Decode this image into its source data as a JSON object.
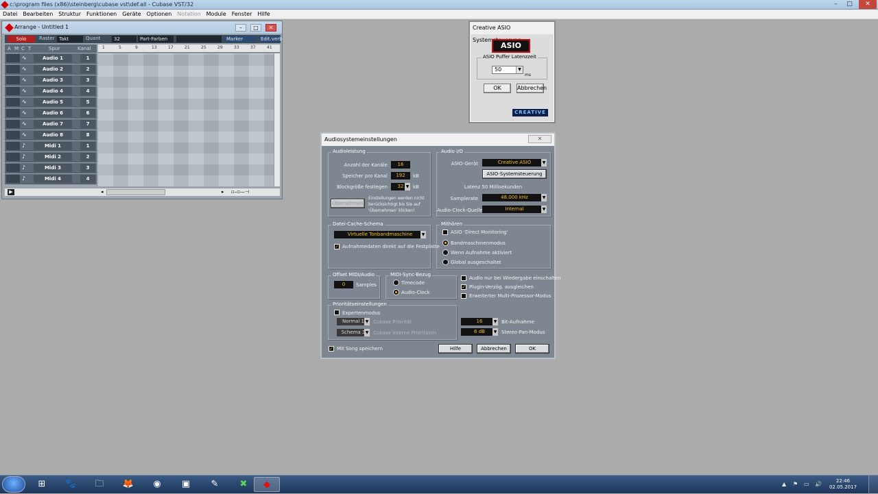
{
  "app": {
    "title": "c:\\program files (x86)\\steinberg\\cubase vst\\def.all - Cubase VST/32",
    "window_buttons": [
      "–",
      "□",
      "✕"
    ]
  },
  "menu": [
    "Datei",
    "Bearbeiten",
    "Struktur",
    "Funktionen",
    "Geräte",
    "Optionen",
    "Notation",
    "Module",
    "Fenster",
    "Hilfe"
  ],
  "menu_disabled": [
    "Notation"
  ],
  "arrange": {
    "title": "Arrange - Untitled 1",
    "solo": "Solo",
    "raster_label": "Raster",
    "raster_value": "Takt",
    "quant_label": "Quant",
    "quant_value": "32",
    "part_colors": "Part-Farben",
    "marker": "Marker",
    "edit": "Edit.verb",
    "col_a": "A",
    "col_m": "M",
    "col_c": "C",
    "col_t": "T",
    "col_spur": "Spur",
    "col_kanal": "Kanal",
    "ruler_marks": [
      "1",
      "5",
      "9",
      "13",
      "17",
      "21",
      "25",
      "29",
      "33",
      "37",
      "41"
    ],
    "tracks": [
      {
        "icon": "∿",
        "name": "Audio 1",
        "ch": "1"
      },
      {
        "icon": "∿",
        "name": "Audio 2",
        "ch": "2"
      },
      {
        "icon": "∿",
        "name": "Audio 3",
        "ch": "3"
      },
      {
        "icon": "∿",
        "name": "Audio 4",
        "ch": "4"
      },
      {
        "icon": "∿",
        "name": "Audio 5",
        "ch": "5"
      },
      {
        "icon": "∿",
        "name": "Audio 6",
        "ch": "6"
      },
      {
        "icon": "∿",
        "name": "Audio 7",
        "ch": "7"
      },
      {
        "icon": "∿",
        "name": "Audio 8",
        "ch": "8"
      },
      {
        "icon": "♪",
        "name": "Midi 1",
        "ch": "1"
      },
      {
        "icon": "♪",
        "name": "Midi 2",
        "ch": "2"
      },
      {
        "icon": "♪",
        "name": "Midi 3",
        "ch": "3"
      },
      {
        "icon": "♪",
        "name": "Midi 4",
        "ch": "4"
      }
    ]
  },
  "asio": {
    "title": "Creative ASIO Systemsteuerung",
    "logo": "ASIO",
    "group": "ASIO Puffer Latenzzeit",
    "latency": "50",
    "unit": "ms",
    "ok": "OK",
    "cancel": "Abbrechen",
    "brand": "CREATIVE"
  },
  "audio": {
    "title": "Audiosystemeinstellungen",
    "close": "✕",
    "leistung": {
      "label": "Audioleistung",
      "channels_label": "Anzahl der Kanäle",
      "channels": "16",
      "mem_label": "Speicher pro Kanal",
      "mem": "192",
      "mem_unit": "kB",
      "block_label": "Blockgröße festlegen",
      "block": "32",
      "block_unit": "kB",
      "apply": "Übernehmen",
      "note": "Einstellungen werden nicht berücksichtigt bis Sie auf 'Übernehmen' klicken!"
    },
    "io": {
      "label": "Audio I/O",
      "device_label": "ASIO-Gerät",
      "device": "Creative ASIO",
      "control_btn": "ASIO-Systemsteuerung",
      "latency": "Latenz 50 Millisekunden",
      "rate_label": "Samplerate",
      "rate": "48.000 kHz",
      "clock_label": "Audio-Clock-Quelle",
      "clock": "Internal"
    },
    "cache": {
      "label": "Datei-Cache-Schema",
      "value": "Virtuelle Tonbandmaschine",
      "record_direct": "Aufnahmedaten direkt auf die Festplatte"
    },
    "monitor": {
      "label": "Mithören",
      "direct": "ASIO 'Direct Monitoring'",
      "opts": [
        "Bandmaschinenmodus",
        "Wenn Aufnahme aktiviert",
        "Global ausgeschaltet"
      ]
    },
    "offset": {
      "label": "Offset MIDI/Audio",
      "value": "0",
      "unit": "Samples"
    },
    "sync": {
      "label": "MIDI-Sync-Bezug",
      "opts": [
        "Timecode",
        "Audio-Clock"
      ]
    },
    "checks": [
      "Audio nur bei Wiedergabe einschalten",
      "Plugin-Verzög. ausgleichen",
      "Erweiterter Multi-Prozessor-Modus"
    ],
    "prio": {
      "label": "Prioritätseinstellungen",
      "expert": "Expertenmodus",
      "p1": "Normal 1",
      "p1_label": "Cubase Priorität",
      "p2": "Schema 3",
      "p2_label": "Cubase Interne Prioritäten"
    },
    "bits": {
      "value": "16",
      "label": "Bit-Aufnahme"
    },
    "pan": {
      "value": "6 dB",
      "label": "Stereo-Pan-Modus"
    },
    "save_song": "Mit Song speichern",
    "help": "Hilfe",
    "cancel": "Abbrechen",
    "ok": "OK"
  },
  "taskbar": {
    "apps": [
      "⊞",
      "🐾",
      "🗀",
      "🦊",
      "◉",
      "▣",
      "✎",
      "✖",
      "◆"
    ],
    "time": "22:46",
    "date": "02.05.2017",
    "tray": [
      "▲",
      "⚑",
      "▭",
      "🔊"
    ]
  }
}
